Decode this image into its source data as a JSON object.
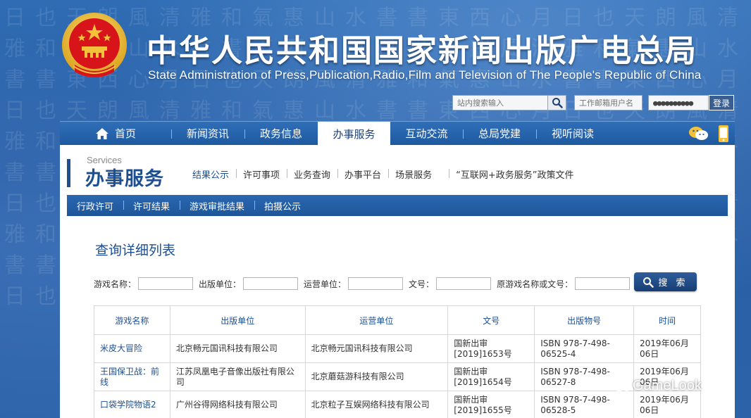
{
  "header": {
    "title_cn": "中华人民共和国国家新闻出版广电总局",
    "title_en": "State Administration of Press,Publication,Radio,Film and Television of The People's Republic of China",
    "search_placeholder": "站内搜索输入",
    "mail_user_placeholder": "工作邮箱用户名",
    "mail_password_value": "●●●●●●●●●●",
    "login_label": "登录"
  },
  "nav": {
    "items": [
      {
        "label": "首页"
      },
      {
        "label": "新闻资讯"
      },
      {
        "label": "政务信息"
      },
      {
        "label": "办事服务"
      },
      {
        "label": "互动交流"
      },
      {
        "label": "总局党建"
      },
      {
        "label": "视听阅读"
      }
    ],
    "active": "办事服务"
  },
  "services": {
    "title_en": "Services",
    "title_cn": "办事服务",
    "sub_nav": [
      {
        "label": "结果公示"
      },
      {
        "label": "许可事项"
      },
      {
        "label": "业务查询"
      },
      {
        "label": "办事平台"
      },
      {
        "label": "场景服务"
      },
      {
        "label": "“互联网+政务服务”政策文件"
      }
    ],
    "tabs": [
      {
        "label": "行政许可"
      },
      {
        "label": "许可结果"
      },
      {
        "label": "游戏审批结果"
      },
      {
        "label": "拍摄公示"
      }
    ]
  },
  "query": {
    "title": "查询详细列表",
    "filters": [
      {
        "label": "游戏名称："
      },
      {
        "label": "出版单位："
      },
      {
        "label": "运营单位："
      },
      {
        "label": "文号："
      },
      {
        "label": "原游戏名称或文号："
      }
    ],
    "search_label": "搜 索"
  },
  "table": {
    "headers": [
      "游戏名称",
      "出版单位",
      "运营单位",
      "文号",
      "出版物号",
      "时间"
    ],
    "rows": [
      [
        "米皮大冒险",
        "北京畅元国讯科技有限公司",
        "北京畅元国讯科技有限公司",
        "国新出审[2019]1653号",
        "ISBN 978-7-498-06525-4",
        "2019年06月06日"
      ],
      [
        "王国保卫战：前线",
        "江苏凤凰电子音像出版社有限公司",
        "北京蘑菇游科技有限公司",
        "国新出审[2019]1654号",
        "ISBN 978-7-498-06527-8",
        "2019年06月06日"
      ],
      [
        "口袋学院物语2",
        "广州谷得网络科技有限公司",
        "北京粒子互娱网络科技有限公司",
        "国新出审[2019]1655号",
        "ISBN 978-7-498-06528-5",
        "2019年06月06日"
      ]
    ]
  },
  "watermark": "GameLook",
  "icons": {
    "home": "home-icon",
    "search": "search-icon",
    "wechat": "wechat-icon",
    "mobile": "mobile-icon",
    "emblem": "national-emblem-icon"
  },
  "colors": {
    "brand_blue": "#1c4f92",
    "nav_blue": "#2a68b1",
    "emblem_red": "#d8141b",
    "emblem_gold": "#f3c23a"
  }
}
